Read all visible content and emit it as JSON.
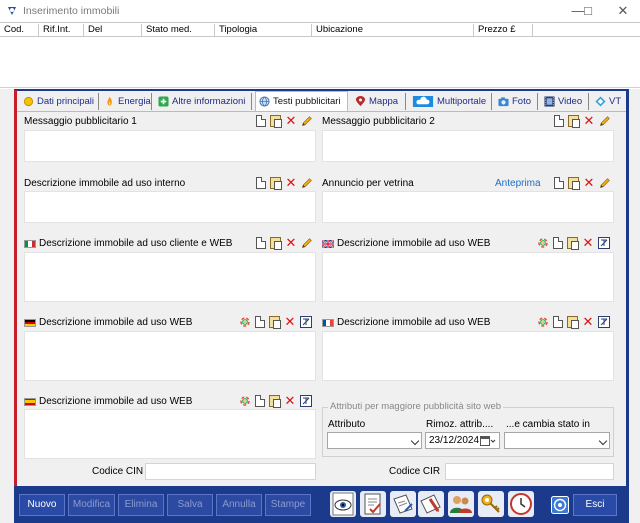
{
  "window": {
    "title": "Inserimento immobili",
    "minimize_glyph": "—",
    "maximize_glyph": "□",
    "close_glyph": "✕"
  },
  "list": {
    "columns": [
      "Cod.",
      "Rif.Int.",
      "Del",
      "Stato med.",
      "Tipologia",
      "Ubicazione",
      "Prezzo £"
    ]
  },
  "tabs": [
    {
      "label": "Dati principali",
      "icon": "sun-icon"
    },
    {
      "label": "Energia",
      "icon": "flame-icon"
    },
    {
      "label": "Altre informazioni",
      "icon": "plus-icon"
    },
    {
      "label": "Testi pubblicitari",
      "icon": "globe-icon",
      "active": true
    },
    {
      "label": "Mappa",
      "icon": "map-pin-icon"
    },
    {
      "label": "Multiportale",
      "icon": "cloud-icon"
    },
    {
      "label": "Foto",
      "icon": "camera-icon"
    },
    {
      "label": "Video",
      "icon": "film-icon"
    },
    {
      "label": "VT",
      "icon": "virtual-tour-icon"
    }
  ],
  "sections": {
    "msg1": "Messaggio pubblicitario 1",
    "msg2": "Messaggio pubblicitario 2",
    "internal": "Descrizione immobile ad uso interno",
    "showcase": "Annuncio per vetrina",
    "preview_link": "Anteprima",
    "it_web": "Descrizione immobile ad uso cliente e WEB",
    "en_web": "Descrizione immobile ad uso WEB",
    "de_web": "Descrizione immobile ad uso WEB",
    "fr_web": "Descrizione immobile ad uso WEB",
    "es_web": "Descrizione immobile ad uso WEB"
  },
  "attributes": {
    "legend": "Attributi per maggiore pubblicità sito web",
    "attr_label": "Attributo",
    "remove_label": "Rimoz. attrib....",
    "change_label": "...e cambia stato in",
    "attr_value": "",
    "remove_date": "23/12/2024",
    "change_value": ""
  },
  "codes": {
    "cin_label": "Codice CIN",
    "cir_label": "Codice CIR",
    "cin_value": "",
    "cir_value": ""
  },
  "buttons": {
    "new": "Nuovo",
    "edit": "Modifica",
    "delete": "Elimina",
    "save": "Salva",
    "cancel": "Annulla",
    "print": "Stampe",
    "exit": "Esci"
  },
  "colors": {
    "accent_blue": "#1b3a8c",
    "accent_red": "#c51f2b",
    "delete_red": "#d11111",
    "link_blue": "#1f6fc2"
  }
}
